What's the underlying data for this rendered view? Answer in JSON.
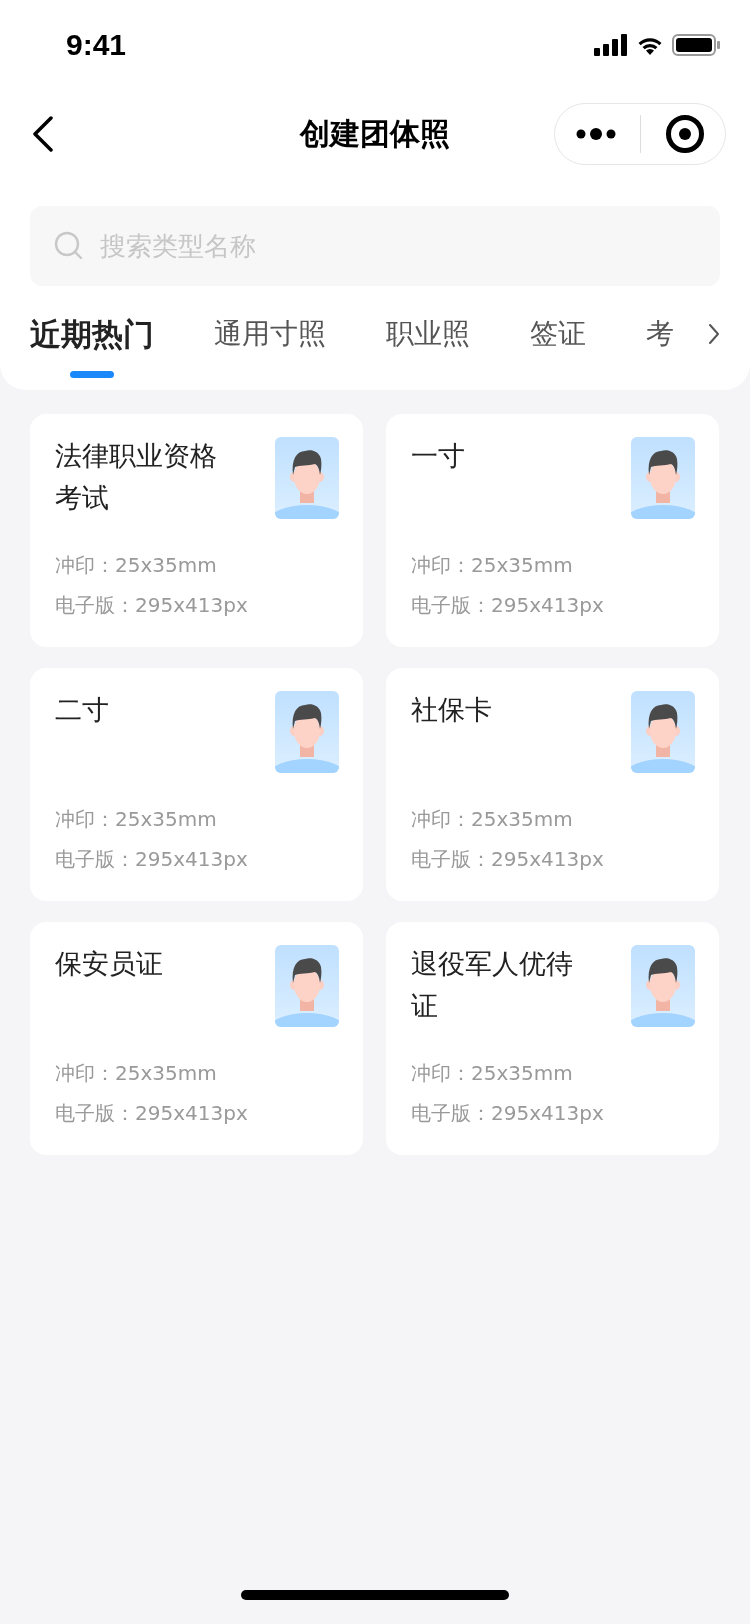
{
  "status_bar": {
    "time": "9:41"
  },
  "nav": {
    "title": "创建团体照"
  },
  "search": {
    "placeholder": "搜索类型名称"
  },
  "tabs": [
    {
      "label": "近期热门",
      "selected": true
    },
    {
      "label": "通用寸照",
      "selected": false
    },
    {
      "label": "职业照",
      "selected": false
    },
    {
      "label": "签证",
      "selected": false
    },
    {
      "label": "考",
      "selected": false
    }
  ],
  "cards": [
    {
      "title": "法律职业资格考试",
      "print": "冲印：25x35mm",
      "digital": "电子版：295x413px"
    },
    {
      "title": "一寸",
      "print": "冲印：25x35mm",
      "digital": "电子版：295x413px"
    },
    {
      "title": "二寸",
      "print": "冲印：25x35mm",
      "digital": "电子版：295x413px"
    },
    {
      "title": "社保卡",
      "print": "冲印：25x35mm",
      "digital": "电子版：295x413px"
    },
    {
      "title": "保安员证",
      "print": "冲印：25x35mm",
      "digital": "电子版：295x413px"
    },
    {
      "title": "退役军人优待证",
      "print": "冲印：25x35mm",
      "digital": "电子版：295x413px"
    }
  ]
}
